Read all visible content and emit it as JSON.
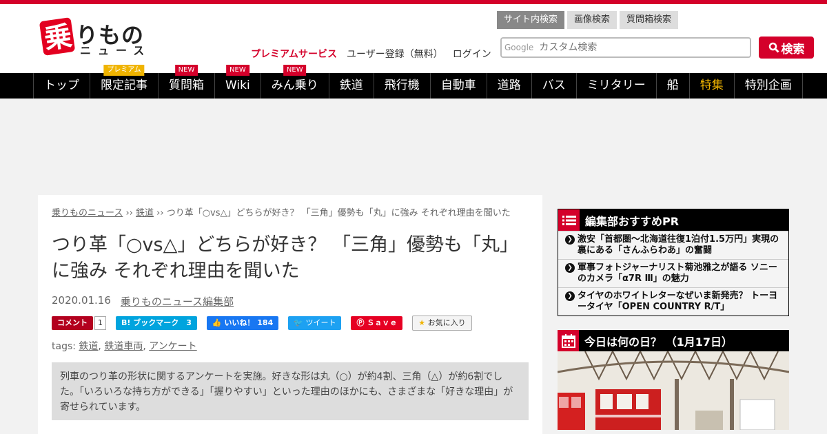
{
  "header": {
    "logo_kanji": "乗",
    "logo_text1": "りもの",
    "logo_text2": "ニュース",
    "premium_link": "プレミアムサービス",
    "register_link": "ユーザー登録（無料）",
    "login_link": "ログイン",
    "search_tabs": [
      "サイト内検索",
      "画像検索",
      "質問箱検索"
    ],
    "search_brand": "Google",
    "search_placeholder": "カスタム検索",
    "search_button": "検索"
  },
  "nav": {
    "items": [
      {
        "label": "トップ",
        "badge": ""
      },
      {
        "label": "限定記事",
        "badge": "プレミアム"
      },
      {
        "label": "質問箱",
        "badge": "NEW"
      },
      {
        "label": "Wiki",
        "badge": "NEW"
      },
      {
        "label": "みん乗り",
        "badge": "NEW"
      },
      {
        "label": "鉄道",
        "badge": ""
      },
      {
        "label": "飛行機",
        "badge": ""
      },
      {
        "label": "自動車",
        "badge": ""
      },
      {
        "label": "道路",
        "badge": ""
      },
      {
        "label": "バス",
        "badge": ""
      },
      {
        "label": "ミリタリー",
        "badge": ""
      },
      {
        "label": "船",
        "badge": ""
      },
      {
        "label": "特集",
        "badge": ""
      },
      {
        "label": "特別企画",
        "badge": ""
      }
    ],
    "highlight_color": "#f0b400"
  },
  "article": {
    "breadcrumb_home": "乗りものニュース",
    "breadcrumb_sep": " ›› ",
    "breadcrumb_cat": "鉄道",
    "breadcrumb_current": "つり革「○vs△」どちらが好き？ 「三角」優勢も「丸」に強み それぞれ理由を聞いた",
    "title": "つり革「○vs△」どちらが好き？ 「三角」優勢も「丸」に強み それぞれ理由を聞いた",
    "date": "2020.01.16",
    "author": "乗りものニュース編集部",
    "share": {
      "comment": "コメント",
      "comment_count": "1",
      "hatena": "B! ブックマーク",
      "hatena_count": "3",
      "fb": "いいね！",
      "fb_count": "184",
      "tweet": "ツイート",
      "pin": "Ｓａｖｅ",
      "fav": "お気に入り"
    },
    "tags_label": "tags:",
    "tags": [
      "鉄道",
      "鉄道車両",
      "アンケート"
    ],
    "summary": "列車のつり革の形状に関するアンケートを実施。好きな形は丸（○）が約4割、三角（△）が約6割でした。「いろいろな持ち方ができる」「握りやすい」といった理由のほかにも、さまざまな「好きな理由」が寄せられています。"
  },
  "sidebar": {
    "pr_title": "編集部おすすめPR",
    "pr_items": [
      "激安「首都圏～北海道往復1泊付1.5万円」実現の裏にある「さんふらわあ」の奮闘",
      "軍事フォトジャーナリスト菊池雅之が語る ソニーのカメラ「α7R Ⅲ」の魅力",
      "タイヤのホワイトレターなぜいま新発売？ トーヨータイヤ「OPEN COUNTRY R/T」"
    ],
    "today_title": "今日は何の日？ （1月17日）"
  },
  "colors": {
    "brand_red": "#d4002a",
    "nav_bg": "#000000"
  }
}
